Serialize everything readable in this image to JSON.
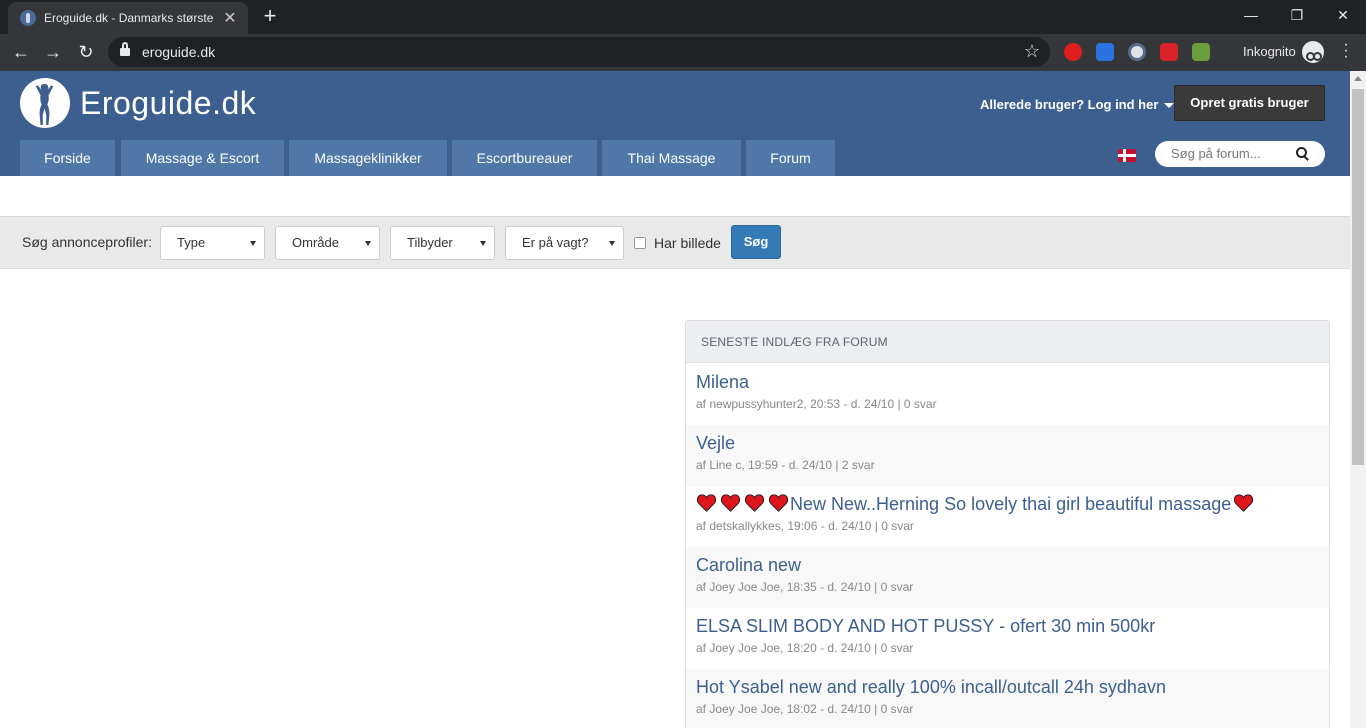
{
  "browser": {
    "tab_title": "Eroguide.dk - Danmarks største g",
    "url": "eroguide.dk",
    "incognito_label": "Inkognito"
  },
  "header": {
    "logo_text": "Eroguide.dk",
    "login_link": "Allerede bruger? Log ind her",
    "signup_button": "Opret gratis bruger",
    "nav": [
      "Forside",
      "Massage & Escort",
      "Massageklinikker",
      "Escortbureauer",
      "Thai Massage",
      "Forum"
    ],
    "forum_search_placeholder": "Søg på forum..."
  },
  "search": {
    "label": "Søg annonceprofiler:",
    "selects": [
      "Type",
      "Område",
      "Tilbyder",
      "Er på vagt?"
    ],
    "checkbox_label": "Har billede",
    "button": "Søg"
  },
  "forum": {
    "heading": "SENESTE INDLÆG FRA FORUM",
    "posts": [
      {
        "title": "Milena",
        "meta": "af newpussyhunter2, 20:53 - d. 24/10 | 0 svar"
      },
      {
        "title": "Vejle",
        "meta": "af Line c, 19:59 - d. 24/10 | 2 svar"
      },
      {
        "title": "New New..Herning So lovely thai girl beautiful massage",
        "meta": "af detskallykkes, 19:06 - d. 24/10 | 0 svar"
      },
      {
        "title": "Carolina new",
        "meta": "af Joey Joe Joe, 18:35 - d. 24/10 | 0 svar"
      },
      {
        "title": "ELSA SLIM BODY AND HOT PUSSY - ofert 30 min 500kr",
        "meta": "af Joey Joe Joe, 18:20 - d. 24/10 | 0 svar"
      },
      {
        "title": "Hot Ysabel new and really 100% incall/outcall 24h sydhavn",
        "meta": "af Joey Joe Joe, 18:02 - d. 24/10 | 0 svar"
      }
    ]
  },
  "colors": {
    "header_bg": "#3d5f8f",
    "nav_tab_bg": "#4f77a7",
    "link": "#3d5f8f",
    "primary_button": "#337ab7",
    "heart": "#e0161d"
  }
}
